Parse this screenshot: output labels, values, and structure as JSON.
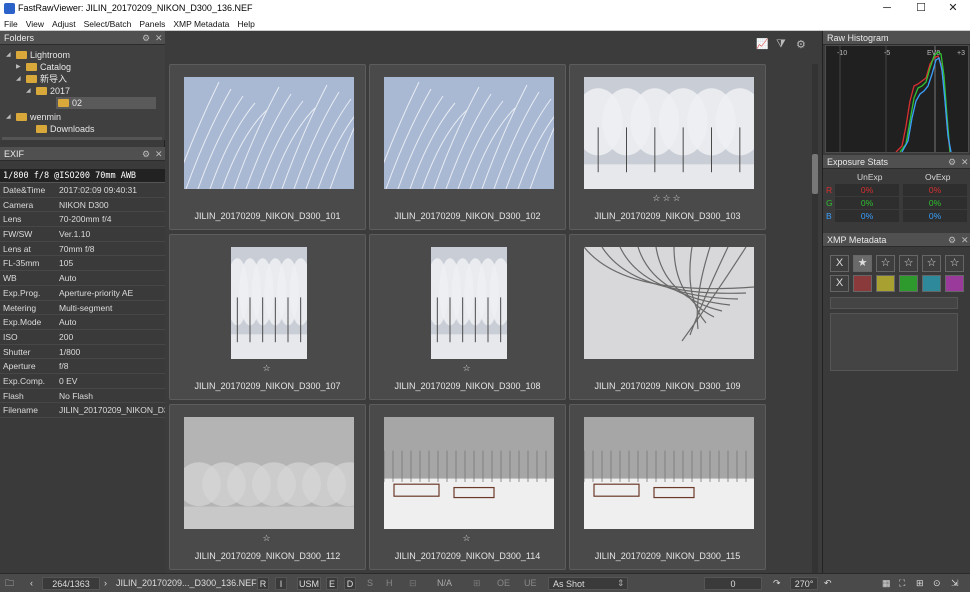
{
  "window": {
    "title": "FastRawViewer: JILIN_20170209_NIKON_D300_136.NEF",
    "minimize": "─",
    "maximize": "☐",
    "close": "✕"
  },
  "menu": [
    "File",
    "View",
    "Adjust",
    "Select/Batch",
    "Panels",
    "XMP Metadata",
    "Help"
  ],
  "folders": {
    "title": "Folders",
    "items": [
      {
        "label": "Lightroom",
        "depth": 1
      },
      {
        "label": "Catalog",
        "depth": 2
      },
      {
        "label": "新导入",
        "depth": 2
      },
      {
        "label": "2017",
        "depth": 3
      },
      {
        "label": "02",
        "depth": 4
      },
      {
        "label": "wenmin",
        "depth": 0
      },
      {
        "label": "Downloads",
        "depth": 1
      }
    ]
  },
  "exif": {
    "title": "EXIF",
    "summary": "1/800 f/8 @ISO200 70mm AWB",
    "rows": [
      {
        "k": "Date&Time",
        "v": "2017:02:09 09:40:31"
      },
      {
        "k": "Camera",
        "v": "NIKON D300"
      },
      {
        "k": "Lens",
        "v": "70-200mm f/4"
      },
      {
        "k": "FW/SW",
        "v": "Ver.1.10"
      },
      {
        "k": "Lens at",
        "v": "70mm f/8"
      },
      {
        "k": "FL-35mm",
        "v": "105"
      },
      {
        "k": "WB",
        "v": "Auto"
      },
      {
        "k": "Exp.Prog.",
        "v": "Aperture-priority AE"
      },
      {
        "k": "Metering",
        "v": "Multi-segment"
      },
      {
        "k": "Exp.Mode",
        "v": "Auto"
      },
      {
        "k": "ISO",
        "v": "200"
      },
      {
        "k": "Shutter",
        "v": "1/800"
      },
      {
        "k": "Aperture",
        "v": "f/8"
      },
      {
        "k": "Exp.Comp.",
        "v": "0 EV"
      },
      {
        "k": "Flash",
        "v": "No Flash"
      },
      {
        "k": "Filename",
        "v": "JILIN_20170209_NIKON_D3"
      }
    ]
  },
  "thumbs": [
    {
      "name": "JILIN_20170209_NIKON_D300_101",
      "stars": ""
    },
    {
      "name": "JILIN_20170209_NIKON_D300_102",
      "stars": ""
    },
    {
      "name": "JILIN_20170209_NIKON_D300_103",
      "stars": "☆☆☆"
    },
    {
      "name": "JILIN_20170209_NIKON_D300_107",
      "stars": "☆"
    },
    {
      "name": "JILIN_20170209_NIKON_D300_108",
      "stars": "☆"
    },
    {
      "name": "JILIN_20170209_NIKON_D300_109",
      "stars": ""
    },
    {
      "name": "JILIN_20170209_NIKON_D300_112",
      "stars": "☆"
    },
    {
      "name": "JILIN_20170209_NIKON_D300_114",
      "stars": "☆"
    },
    {
      "name": "JILIN_20170209_NIKON_D300_115",
      "stars": ""
    }
  ],
  "histogram": {
    "title": "Raw Histogram",
    "ticks": [
      "-10",
      "-5",
      "EV0",
      "+3"
    ]
  },
  "exposure": {
    "title": "Exposure Stats",
    "headers": [
      "UnExp",
      "OvExp"
    ],
    "rows": [
      {
        "ch": "R",
        "un": "0%",
        "ov": "0%",
        "color": "#d83030"
      },
      {
        "ch": "G",
        "un": "0%",
        "ov": "0%",
        "color": "#30c030"
      },
      {
        "ch": "B",
        "un": "0%",
        "ov": "0%",
        "color": "#3aa0ff"
      }
    ]
  },
  "xmp": {
    "title": "XMP Metadata",
    "reject": "X",
    "rating_icons": [
      "★",
      "☆",
      "☆",
      "☆",
      "☆"
    ],
    "colors": [
      "#8a3a3a",
      "#a8a030",
      "#2e9a2e",
      "#2e8a9a",
      "#9a3a9a"
    ]
  },
  "status": {
    "counter": "264/1363",
    "filename": "JILIN_20170209..._D300_136.NEF",
    "r": "R",
    "i": "I",
    "usm": "USM",
    "e": "E",
    "d": "D",
    "s": "S",
    "h": "H",
    "na": "N/A",
    "oe": "OE",
    "ue": "UE",
    "wb": "As Shot",
    "exp": "0",
    "rotation": "270°"
  }
}
